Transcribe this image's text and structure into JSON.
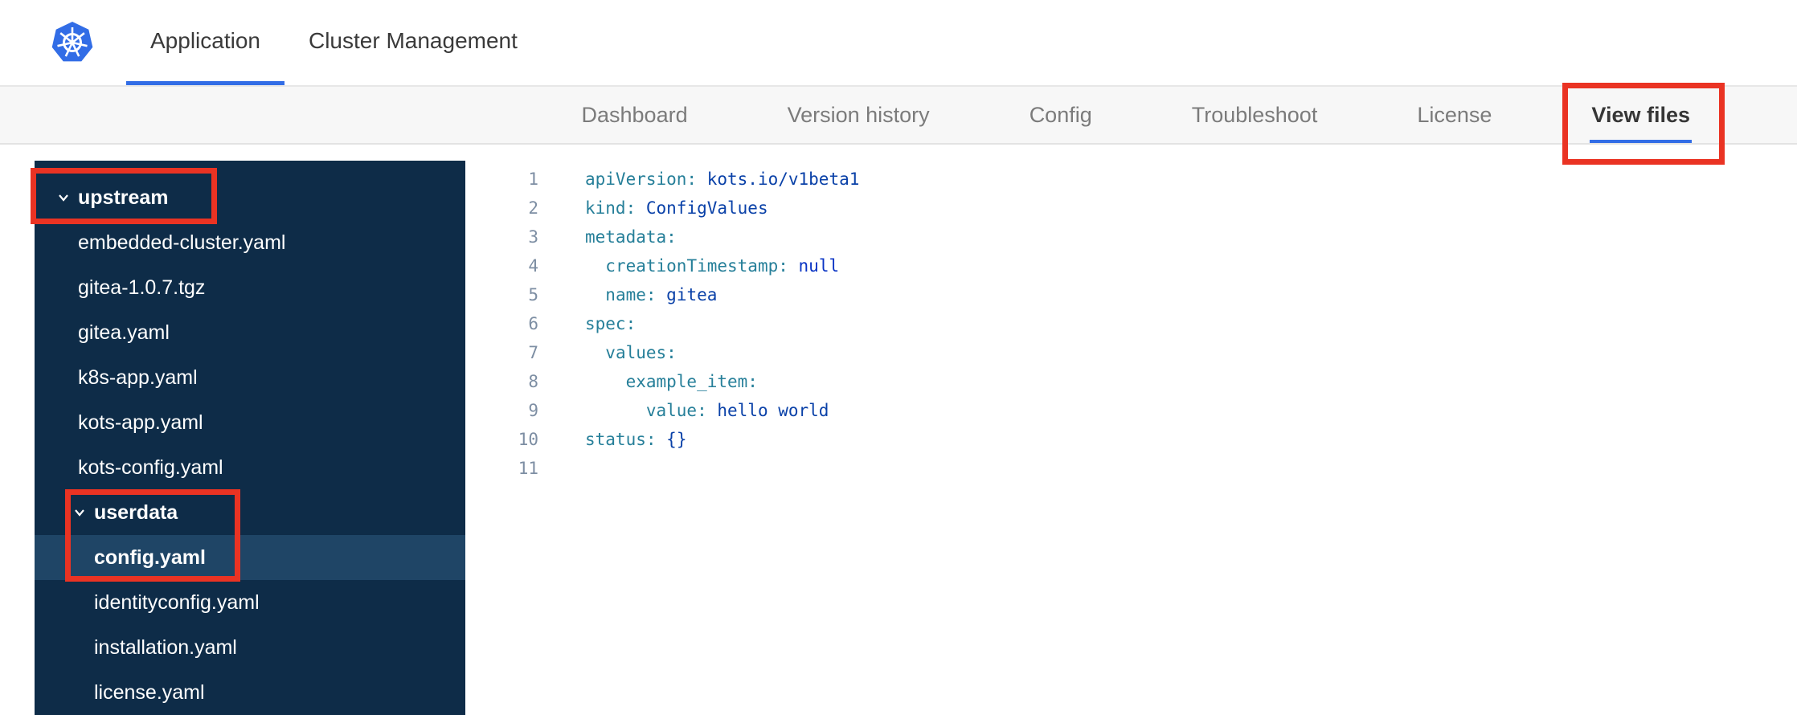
{
  "colors": {
    "accent_blue": "#326de6",
    "annotation_red": "#ea3323",
    "sidebar_bg": "#0e2c48",
    "sidebar_selected": "#1f4566",
    "code_key": "#267f99",
    "code_value": "#0a41a8",
    "code_keyword": "#0a34c4",
    "line_number": "#7d8ea3"
  },
  "header": {
    "tabs": [
      {
        "label": "Application",
        "active": true
      },
      {
        "label": "Cluster Management",
        "active": false
      }
    ]
  },
  "subnav": {
    "items": [
      {
        "label": "Dashboard",
        "active": false
      },
      {
        "label": "Version history",
        "active": false
      },
      {
        "label": "Config",
        "active": false
      },
      {
        "label": "Troubleshoot",
        "active": false
      },
      {
        "label": "License",
        "active": false
      },
      {
        "label": "View files",
        "active": true,
        "annotated": true
      }
    ]
  },
  "file_tree": {
    "items": [
      {
        "label": "upstream",
        "kind": "folder",
        "level": 0,
        "expanded": true,
        "annotated": true
      },
      {
        "label": "embedded-cluster.yaml",
        "kind": "file",
        "level": 1
      },
      {
        "label": "gitea-1.0.7.tgz",
        "kind": "file",
        "level": 1
      },
      {
        "label": "gitea.yaml",
        "kind": "file",
        "level": 1
      },
      {
        "label": "k8s-app.yaml",
        "kind": "file",
        "level": 1
      },
      {
        "label": "kots-app.yaml",
        "kind": "file",
        "level": 1
      },
      {
        "label": "kots-config.yaml",
        "kind": "file",
        "level": 1
      },
      {
        "label": "userdata",
        "kind": "folder",
        "level": 1,
        "expanded": true,
        "annotated": true
      },
      {
        "label": "config.yaml",
        "kind": "file",
        "level": 2,
        "selected": true,
        "annotated": true
      },
      {
        "label": "identityconfig.yaml",
        "kind": "file",
        "level": 2
      },
      {
        "label": "installation.yaml",
        "kind": "file",
        "level": 2
      },
      {
        "label": "license.yaml",
        "kind": "file",
        "level": 2
      }
    ]
  },
  "editor": {
    "language": "yaml",
    "lines": [
      [
        [
          "key",
          "apiVersion:"
        ],
        [
          "p",
          " "
        ],
        [
          "val",
          "kots.io/v1beta1"
        ]
      ],
      [
        [
          "key",
          "kind:"
        ],
        [
          "p",
          " "
        ],
        [
          "val",
          "ConfigValues"
        ]
      ],
      [
        [
          "key",
          "metadata:"
        ]
      ],
      [
        [
          "p",
          "  "
        ],
        [
          "key",
          "creationTimestamp:"
        ],
        [
          "p",
          " "
        ],
        [
          "kw",
          "null"
        ]
      ],
      [
        [
          "p",
          "  "
        ],
        [
          "key",
          "name:"
        ],
        [
          "p",
          " "
        ],
        [
          "val",
          "gitea"
        ]
      ],
      [
        [
          "key",
          "spec:"
        ]
      ],
      [
        [
          "p",
          "  "
        ],
        [
          "key",
          "values:"
        ]
      ],
      [
        [
          "p",
          "    "
        ],
        [
          "key",
          "example_item:"
        ]
      ],
      [
        [
          "p",
          "      "
        ],
        [
          "key",
          "value:"
        ],
        [
          "p",
          " "
        ],
        [
          "val",
          "hello world"
        ]
      ],
      [
        [
          "key",
          "status:"
        ],
        [
          "p",
          " "
        ],
        [
          "val",
          "{}"
        ]
      ],
      []
    ]
  },
  "annotations": [
    {
      "name": "upstream-folder-highlight"
    },
    {
      "name": "userdata-config-highlight"
    },
    {
      "name": "view-files-tab-highlight"
    }
  ]
}
